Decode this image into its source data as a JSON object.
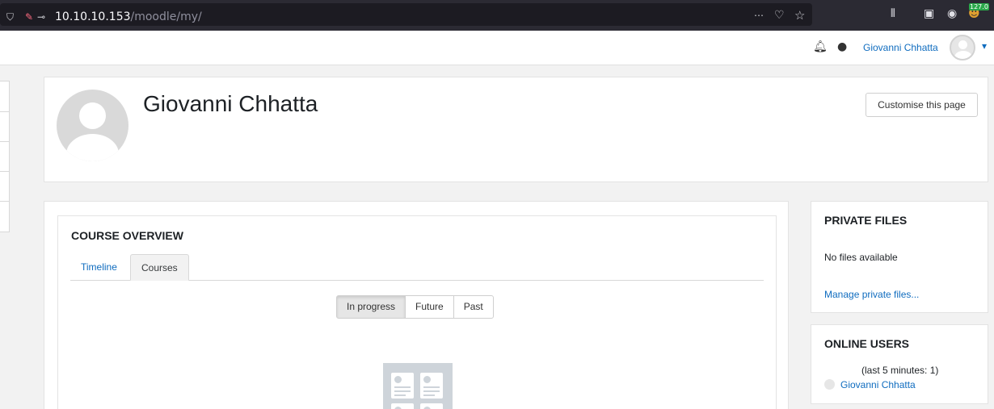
{
  "browser": {
    "url_host": "10.10.10.153",
    "url_path": "/moodle/my/",
    "badge": "127.0"
  },
  "nav": {
    "user_name": "Giovanni Chhatta"
  },
  "header": {
    "title": "Giovanni Chhatta",
    "customise_label": "Customise this page"
  },
  "course_overview": {
    "title": "COURSE OVERVIEW",
    "tabs": [
      {
        "label": "Timeline",
        "active": false
      },
      {
        "label": "Courses",
        "active": true
      }
    ],
    "filters": [
      {
        "label": "In progress",
        "active": true
      },
      {
        "label": "Future",
        "active": false
      },
      {
        "label": "Past",
        "active": false
      }
    ]
  },
  "private_files": {
    "title": "PRIVATE FILES",
    "empty_text": "No files available",
    "manage_link": "Manage private files..."
  },
  "online_users": {
    "title": "ONLINE USERS",
    "period_text": "(last 5 minutes: 1)",
    "users": [
      "Giovanni Chhatta"
    ]
  },
  "colors": {
    "link": "#0f6cbf",
    "browser_bar": "#2b2a33"
  }
}
